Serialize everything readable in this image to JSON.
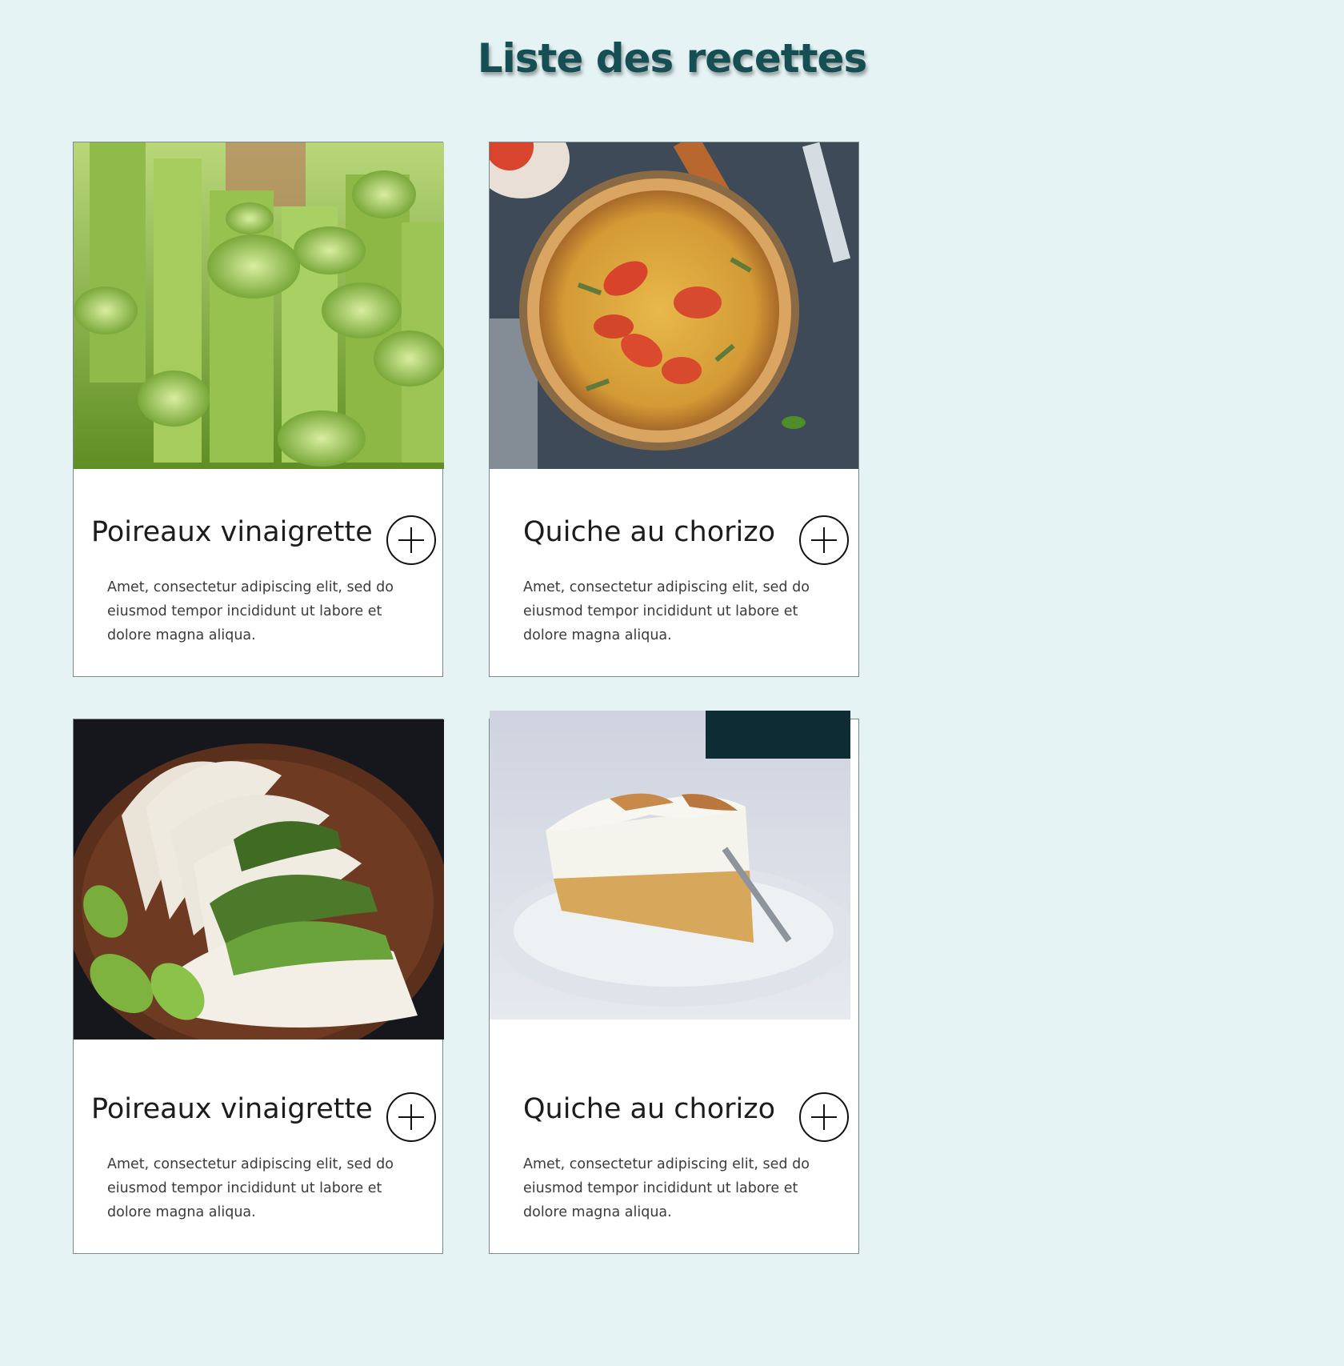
{
  "page": {
    "title": "Liste des recettes"
  },
  "recipes": [
    {
      "title": "Poireaux vinaigrette",
      "description": "Amet, consectetur adipiscing elit, sed do eiusmod tempor incididunt ut labore et dolore magna aliqua.",
      "image": "leeks-photo",
      "button_icon": "plus-circle-icon"
    },
    {
      "title": "Quiche au chorizo",
      "description": "Amet, consectetur adipiscing elit, sed do eiusmod tempor incididunt ut labore et dolore magna aliqua.",
      "image": "quiche-photo",
      "button_icon": "plus-circle-icon"
    },
    {
      "title": "Poireaux vinaigrette",
      "description": "Amet, consectetur adipiscing elit, sed do eiusmod tempor incididunt ut labore et dolore magna aliqua.",
      "image": "tacos-photo",
      "button_icon": "plus-circle-icon"
    },
    {
      "title": "Quiche au chorizo",
      "description": "Amet, consectetur adipiscing elit, sed do eiusmod tempor incididunt ut labore et dolore magna aliqua.",
      "image": "lemon-meringue-pie-photo",
      "button_icon": "plus-circle-icon"
    }
  ],
  "colors": {
    "background": "#e5f3f4",
    "title": "#154f53",
    "card": "#ffffff",
    "card_border": "#7d8a8c"
  }
}
